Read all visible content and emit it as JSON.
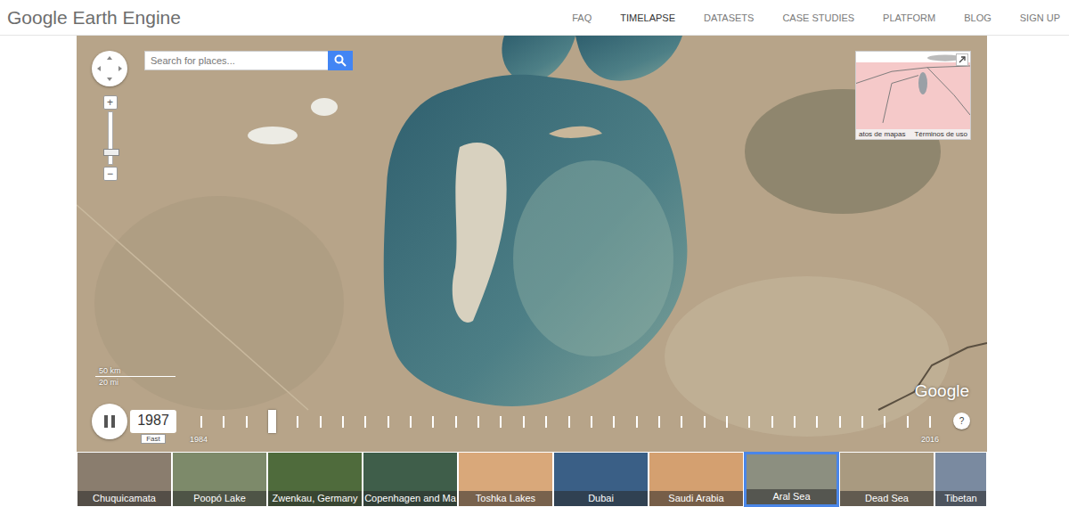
{
  "header": {
    "logo": "Google Earth Engine",
    "nav": [
      {
        "label": "FAQ",
        "selected": false
      },
      {
        "label": "TIMELAPSE",
        "selected": true
      },
      {
        "label": "DATASETS",
        "selected": false
      },
      {
        "label": "CASE STUDIES",
        "selected": false
      },
      {
        "label": "PLATFORM",
        "selected": false
      },
      {
        "label": "BLOG",
        "selected": false
      },
      {
        "label": "SIGN UP",
        "selected": false
      }
    ]
  },
  "search": {
    "placeholder": "Search for places..."
  },
  "zoom": {
    "in": "+",
    "out": "−",
    "level": 0.2
  },
  "minimap": {
    "attribution": "atos de mapas",
    "terms": "Términos de uso"
  },
  "scale": {
    "metric": "50 km",
    "imperial": "20 mi"
  },
  "watermark": "Google",
  "timeline": {
    "playing": true,
    "year": "1987",
    "speed": "Fast",
    "start": "1984",
    "end": "2016",
    "help": "?",
    "ticks": [
      {
        "selected": false
      },
      {
        "selected": false
      },
      {
        "selected": false
      },
      {
        "selected": true
      },
      {
        "selected": false
      },
      {
        "selected": false
      },
      {
        "selected": false
      },
      {
        "selected": false
      },
      {
        "selected": false
      },
      {
        "selected": false
      },
      {
        "selected": false
      },
      {
        "selected": false
      },
      {
        "selected": false
      },
      {
        "selected": false
      },
      {
        "selected": false
      },
      {
        "selected": false
      },
      {
        "selected": false
      },
      {
        "selected": false
      },
      {
        "selected": false
      },
      {
        "selected": false
      },
      {
        "selected": false
      },
      {
        "selected": false
      },
      {
        "selected": false
      },
      {
        "selected": false
      },
      {
        "selected": false
      },
      {
        "selected": false
      },
      {
        "selected": false
      },
      {
        "selected": false
      },
      {
        "selected": false
      },
      {
        "selected": false
      },
      {
        "selected": false
      },
      {
        "selected": false
      },
      {
        "selected": false
      }
    ]
  },
  "places": [
    {
      "label": "Chuquicamata",
      "selected": false,
      "color": "#8a7d6e"
    },
    {
      "label": "Poopó Lake",
      "selected": false,
      "color": "#7d8a6a"
    },
    {
      "label": "Zwenkau, Germany",
      "selected": false,
      "color": "#4f6b3c"
    },
    {
      "label": "Copenhagen and Ma",
      "selected": false,
      "color": "#3f5e4a"
    },
    {
      "label": "Toshka Lakes",
      "selected": false,
      "color": "#d9a87a"
    },
    {
      "label": "Dubai",
      "selected": false,
      "color": "#3a5f86"
    },
    {
      "label": "Saudi Arabia",
      "selected": false,
      "color": "#d4a070"
    },
    {
      "label": "Aral Sea",
      "selected": true,
      "color": "#8c8f80"
    },
    {
      "label": "Dead Sea",
      "selected": false,
      "color": "#a99a80"
    },
    {
      "label": "Tibetan",
      "selected": false,
      "color": "#7a8aa0"
    }
  ]
}
